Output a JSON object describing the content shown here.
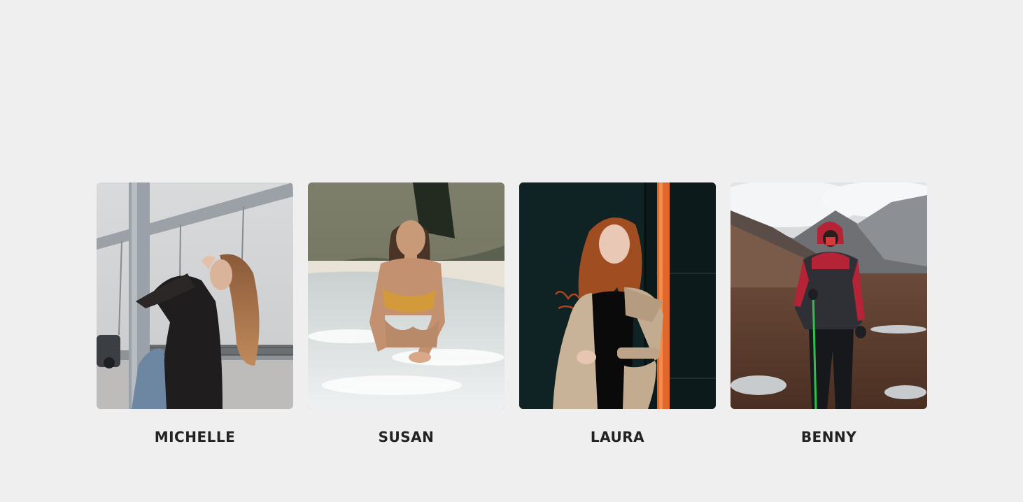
{
  "people": [
    {
      "name": "MICHELLE",
      "photo": "woman-on-bridge-photo"
    },
    {
      "name": "SUSAN",
      "photo": "woman-on-beach-photo"
    },
    {
      "name": "LAURA",
      "photo": "woman-in-trench-coat-photo"
    },
    {
      "name": "BENNY",
      "photo": "hiker-in-mountains-photo"
    }
  ],
  "colors": {
    "background": "#efefef",
    "name_text": "#222222"
  }
}
